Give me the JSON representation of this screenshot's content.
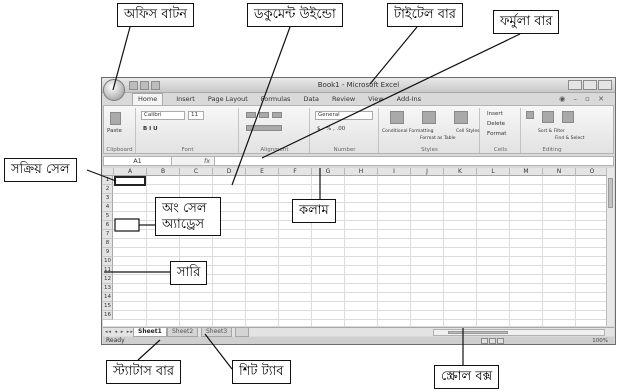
{
  "callouts": {
    "office_button": "অফিস বাটন",
    "document_window": "ডকুমেন্ট উইন্ডো",
    "title_bar": "টাইটেল বার",
    "formula_bar": "ফর্মুলা বার",
    "active_cell": "সক্রিয় সেল",
    "cell_address": "অং সেল অ্যাড্রেস",
    "column": "কলাম",
    "row": "সারি",
    "status_bar": "স্ট্যাটাস বার",
    "sheet_tab": "শিট ট্যাব",
    "scroll_box": "স্ক্রোল বক্স"
  },
  "window": {
    "title": "Book1 - Microsoft Excel",
    "tabs": [
      "Home",
      "Insert",
      "Page Layout",
      "Formulas",
      "Data",
      "Review",
      "View",
      "Add-Ins"
    ],
    "help_controls": "◉ – ▫ ✕"
  },
  "ribbon": {
    "clipboard": {
      "label": "Clipboard",
      "paste": "Paste"
    },
    "font": {
      "label": "Font",
      "font_name": "Calibri",
      "font_size": "11",
      "format_buttons": "B  I  U"
    },
    "alignment": {
      "label": "Alignment"
    },
    "number": {
      "label": "Number",
      "format": "General",
      "symbols": "$ - % ,  .00"
    },
    "styles": {
      "label": "Styles",
      "conditional": "Conditional Formatting",
      "format_table": "Format as Table",
      "cell_styles": "Cell Styles"
    },
    "cells": {
      "label": "Cells",
      "insert": "Insert",
      "delete": "Delete",
      "format": "Format"
    },
    "editing": {
      "label": "Editing",
      "sort": "Sort & Filter",
      "find": "Find & Select"
    }
  },
  "formula_bar": {
    "name_box": "A1",
    "fx": "fx"
  },
  "grid": {
    "columns": [
      "A",
      "B",
      "C",
      "D",
      "E",
      "F",
      "G",
      "H",
      "I",
      "J",
      "K",
      "L",
      "M",
      "N",
      "O"
    ],
    "rows": [
      "1",
      "2",
      "3",
      "4",
      "5",
      "6",
      "7",
      "8",
      "9",
      "10",
      "11",
      "12",
      "13",
      "14",
      "15",
      "16"
    ]
  },
  "sheets": {
    "nav": "◂◂ ◂ ▸ ▸▸",
    "tabs": [
      "Sheet1",
      "Sheet2",
      "Sheet3"
    ],
    "active": "Sheet1"
  },
  "status": {
    "text": "Ready",
    "zoom": "100%"
  }
}
